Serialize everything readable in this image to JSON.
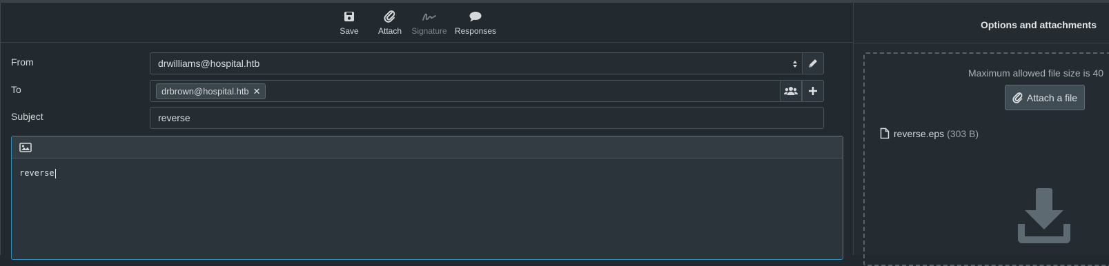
{
  "toolbar": {
    "save": {
      "label": "Save",
      "icon": "floppy-disk-icon"
    },
    "attach": {
      "label": "Attach",
      "icon": "paperclip-icon"
    },
    "signature": {
      "label": "Signature",
      "icon": "signature-icon",
      "disabled": true
    },
    "responses": {
      "label": "Responses",
      "icon": "speech-bubble-icon"
    }
  },
  "compose": {
    "from": {
      "label": "From",
      "value": "drwilliams@hospital.htb"
    },
    "to": {
      "label": "To",
      "recipients": [
        "drbrown@hospital.htb"
      ]
    },
    "subject": {
      "label": "Subject",
      "value": "reverse"
    },
    "body": "reverse"
  },
  "side": {
    "title": "Options and attachments",
    "max_size_text": "Maximum allowed file size is 40",
    "attach_button": "Attach a file",
    "attachments": [
      {
        "name": "reverse.eps",
        "size": "(303 B)"
      }
    ]
  },
  "colors": {
    "background": "#22292e",
    "editor_focus_border": "#2b8fbf",
    "button_bg": "#3f4c54"
  }
}
